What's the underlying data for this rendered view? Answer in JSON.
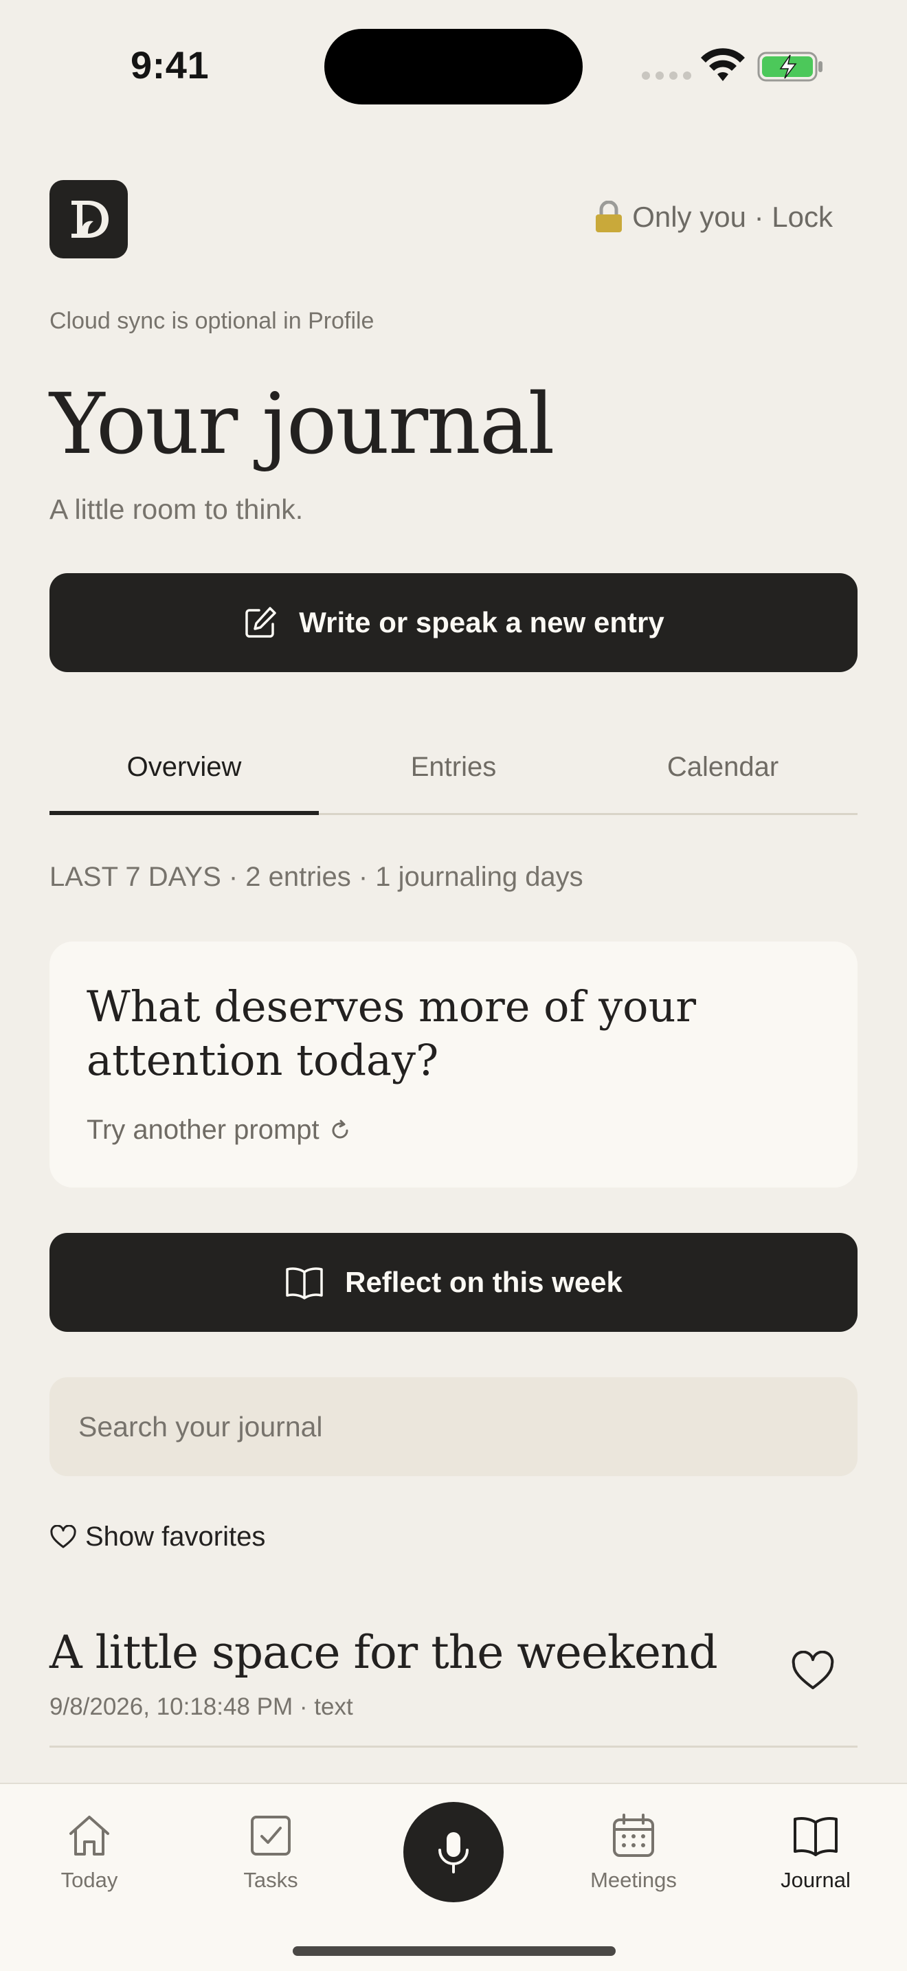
{
  "status": {
    "time": "9:41",
    "icons": [
      "signal-dots",
      "wifi-icon",
      "battery-charging-icon"
    ]
  },
  "header": {
    "logo_letter": "D",
    "privacy_label": "Only you · Lock",
    "lock_icon": "lock-icon"
  },
  "sync_note": "Cloud sync is optional in Profile",
  "page": {
    "title": "Your journal",
    "subtitle": "A little room to think."
  },
  "actions": {
    "new_entry_label": "Write or speak a new entry",
    "reflect_label": "Reflect on this week"
  },
  "tabs": [
    {
      "label": "Overview",
      "active": true
    },
    {
      "label": "Entries",
      "active": false
    },
    {
      "label": "Calendar",
      "active": false
    }
  ],
  "stats": "LAST 7 DAYS · 2 entries · 1 journaling days",
  "prompt": {
    "text": "What deserves more of your attention today?",
    "retry_label": "Try another prompt"
  },
  "search": {
    "placeholder": "Search your journal",
    "value": ""
  },
  "favorites_label": "Show favorites",
  "entries": [
    {
      "title": "A little space for the weekend",
      "meta": "9/8/2026, 10:18:48 PM · text"
    }
  ],
  "tabbar": {
    "items": [
      {
        "label": "Today",
        "icon": "home-icon",
        "active": false
      },
      {
        "label": "Tasks",
        "icon": "checkbox-icon",
        "active": false
      },
      {
        "label": "Meetings",
        "icon": "calendar-icon",
        "active": false
      },
      {
        "label": "Journal",
        "icon": "book-icon",
        "active": true
      }
    ],
    "center_icon": "mic-icon"
  },
  "colors": {
    "background": "#f2efe9",
    "dark": "#232220",
    "card": "#faf8f3",
    "battery_green": "#4cc85a"
  }
}
